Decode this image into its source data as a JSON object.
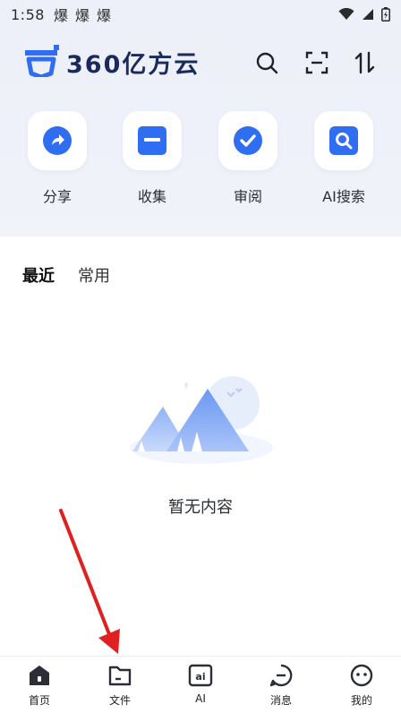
{
  "status": {
    "time": "1:58",
    "notif": "爆"
  },
  "header": {
    "brand": "360亿方云"
  },
  "quick_actions": [
    {
      "label": "分享",
      "icon": "share-icon"
    },
    {
      "label": "收集",
      "icon": "collect-icon"
    },
    {
      "label": "审阅",
      "icon": "review-icon"
    },
    {
      "label": "AI搜索",
      "icon": "ai-search-icon"
    }
  ],
  "tabs": [
    {
      "label": "最近"
    },
    {
      "label": "常用"
    }
  ],
  "empty": {
    "text": "暂无内容"
  },
  "nav": [
    {
      "label": "首页",
      "icon": "home-icon"
    },
    {
      "label": "文件",
      "icon": "file-icon"
    },
    {
      "label": "AI",
      "icon": "ai-icon"
    },
    {
      "label": "消息",
      "icon": "message-icon"
    },
    {
      "label": "我的",
      "icon": "profile-icon"
    }
  ],
  "colors": {
    "accent": "#2f6df2",
    "brand": "#1b2a5c",
    "annotation": "#e02020"
  }
}
